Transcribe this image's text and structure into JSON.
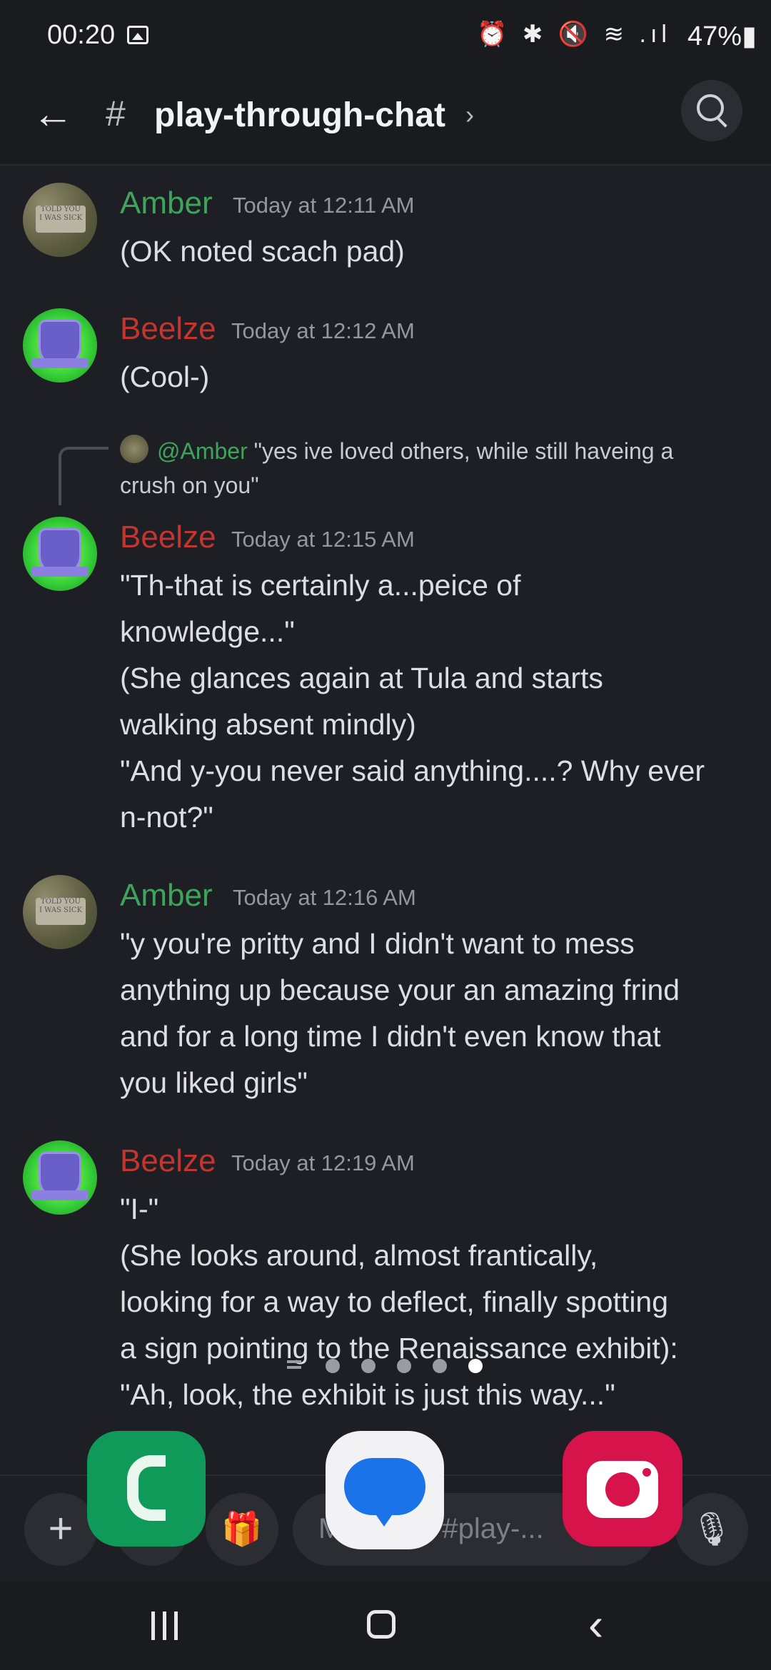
{
  "status_bar": {
    "time": "00:20",
    "system_icons": "⏰ ✱ 🔇 ≋ .ıl",
    "battery": "47%▮"
  },
  "header": {
    "back_icon": "arrow-left-icon",
    "hash": "#",
    "channel_name": "play-through-chat",
    "chevron": "›",
    "search_icon": "search-icon"
  },
  "messages": [
    {
      "author": "Amber",
      "timestamp": "Today at 12:11 AM",
      "lines": [
        "(OK noted scach pad)"
      ]
    },
    {
      "author": "Beelze",
      "timestamp": "Today at 12:12 AM",
      "lines": [
        "(Cool-)"
      ]
    },
    {
      "reply": {
        "mention": "@Amber",
        "text": "\"yes ive loved others, while still haveing a crush on you\""
      },
      "author": "Beelze",
      "timestamp": "Today at 12:15 AM",
      "lines": [
        "\"Th-that is certainly a...peice of",
        "knowledge...\"",
        "(She glances again at Tula and starts",
        "walking absent mindly)",
        "\"And y-you never said anything....? Why ever",
        "n-not?\""
      ]
    },
    {
      "author": "Amber",
      "timestamp": "Today at 12:16 AM",
      "lines": [
        "\"y you're pritty and I didn't want to mess",
        "anything up because your an amazing frind",
        "and for a long time I didn't even know that",
        "you liked girls\""
      ]
    },
    {
      "author": "Beelze",
      "timestamp": "Today at 12:19 AM",
      "lines": [
        "\"I-\"",
        "(She looks around, almost frantically,",
        "looking for a way to deflect, finally spotting",
        "a sign pointing to the Renaissance exhibit):",
        "\"Ah, look, the exhibit is just this way...\""
      ]
    }
  ],
  "input_bar": {
    "add_label": "+",
    "placeholder": "Message #play-..."
  },
  "dock": [
    "phone-app",
    "messages-app",
    "camera-app"
  ],
  "colors": {
    "amber": "#3ea45c",
    "beelze": "#c2362f",
    "background": "#1e1f24"
  }
}
